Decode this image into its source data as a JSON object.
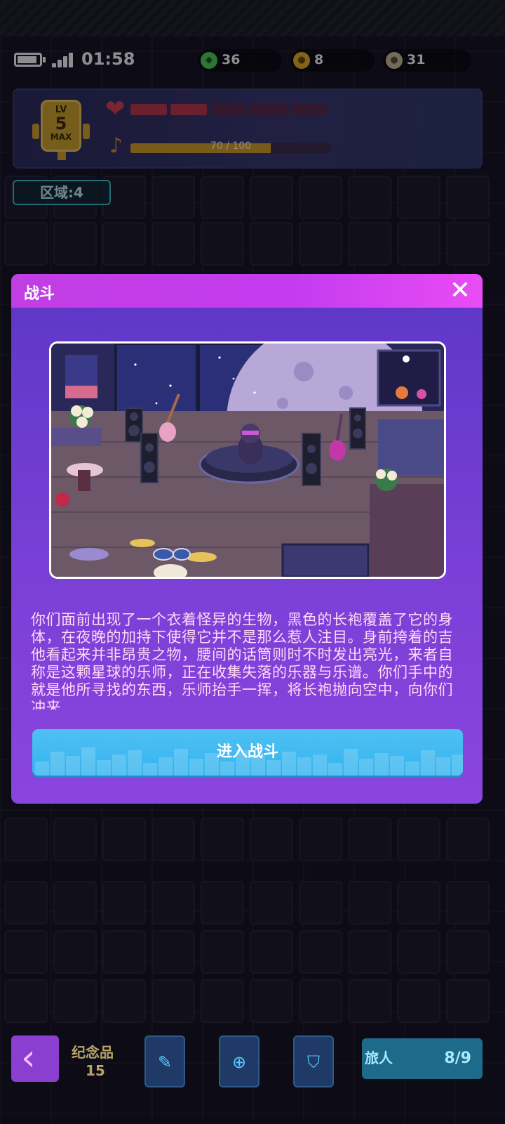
{
  "status_bar": {
    "time": "01:58",
    "battery_level": 0.9
  },
  "currencies": [
    {
      "icon": "green-gem-icon",
      "value": "36",
      "color": "#4fcf5a"
    },
    {
      "icon": "gold-coin-icon",
      "value": "8",
      "color": "#e8b323"
    },
    {
      "icon": "silver-coin-icon",
      "value": "31",
      "color": "#cdbf9a"
    }
  ],
  "level": {
    "lv": "LV",
    "value": "5",
    "max": "MAX",
    "hp_fraction": 0.4,
    "xp_text": "70 / 100",
    "xp_fraction": 0.7
  },
  "region": "区域:4",
  "modal": {
    "title": "战斗",
    "close_icon": "close-icon",
    "story": "你们面前出现了一个衣着怪异的生物，黑色的长袍覆盖了它的身体，在夜晚的加持下使得它并不是那么惹人注目。身前挎着的吉他看起来并非昂贵之物，腰间的话筒则时不时发出亮光，来者自称是这颗星球的乐师，正在收集失落的乐器与乐谱。你们手中的就是他所寻找的东西，乐师抬手一挥，将长袍抛向空中，向你们冲来",
    "enter_button": "进入战斗"
  },
  "bottom": {
    "back_icon": "chevron-left-icon",
    "souvenir_label": "纪念品",
    "souvenir_count": "15",
    "traveler_label": "旅人",
    "traveler_count": "8/9"
  },
  "colors": {
    "modal_header": "#c33cef",
    "modal_body": "#7a3fd6",
    "enter_button": "#3db8f0",
    "story_text": "#ffd9f8"
  }
}
